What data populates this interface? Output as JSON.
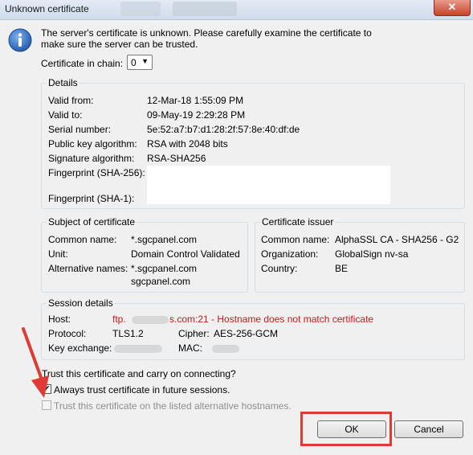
{
  "window": {
    "title": "Unknown certificate",
    "close_glyph": "✕"
  },
  "message": "The server's certificate is unknown. Please carefully examine the certificate to make sure the server can be trusted.",
  "chain": {
    "label": "Certificate in chain:",
    "value": "0"
  },
  "details": {
    "title": "Details",
    "valid_from_label": "Valid from:",
    "valid_from": "12-Mar-18 1:55:09 PM",
    "valid_to_label": "Valid to:",
    "valid_to": "09-May-19 2:29:28 PM",
    "serial_label": "Serial number:",
    "serial": "5e:52:a7:b7:d1:28:2f:57:8e:40:df:de",
    "pk_algo_label": "Public key algorithm:",
    "pk_algo": "RSA with 2048 bits",
    "sig_algo_label": "Signature algorithm:",
    "sig_algo": "RSA-SHA256",
    "fp256_label": "Fingerprint (SHA-256):",
    "fp1_label": "Fingerprint (SHA-1):"
  },
  "subject": {
    "title": "Subject of certificate",
    "cn_label": "Common name:",
    "cn": "*.sgcpanel.com",
    "unit_label": "Unit:",
    "unit": "Domain Control Validated",
    "alt_label": "Alternative names:",
    "alt1": "*.sgcpanel.com",
    "alt2": "sgcpanel.com"
  },
  "issuer": {
    "title": "Certificate issuer",
    "cn_label": "Common name:",
    "cn": "AlphaSSL CA - SHA256 - G2",
    "org_label": "Organization:",
    "org": "GlobalSign nv-sa",
    "country_label": "Country:",
    "country": "BE"
  },
  "session": {
    "title": "Session details",
    "host_label": "Host:",
    "host_prefix": "ftp.",
    "host_suffix": "s.com:21 - Hostname does not match certificate",
    "protocol_label": "Protocol:",
    "protocol": "TLS1.2",
    "cipher_label": "Cipher:",
    "cipher": "AES-256-GCM",
    "kex_label": "Key exchange:",
    "mac_label": "MAC:"
  },
  "trust": {
    "question": "Trust this certificate and carry on connecting?",
    "always_label": "Always trust certificate in future sessions.",
    "always_checked": true,
    "alt_hosts_label": "Trust this certificate on the listed alternative hostnames.",
    "alt_hosts_checked": false
  },
  "buttons": {
    "ok": "OK",
    "cancel": "Cancel"
  },
  "colors": {
    "warning": "#cc1a1a",
    "annotation": "#e03a34",
    "info_icon": "#2f6dc1"
  }
}
